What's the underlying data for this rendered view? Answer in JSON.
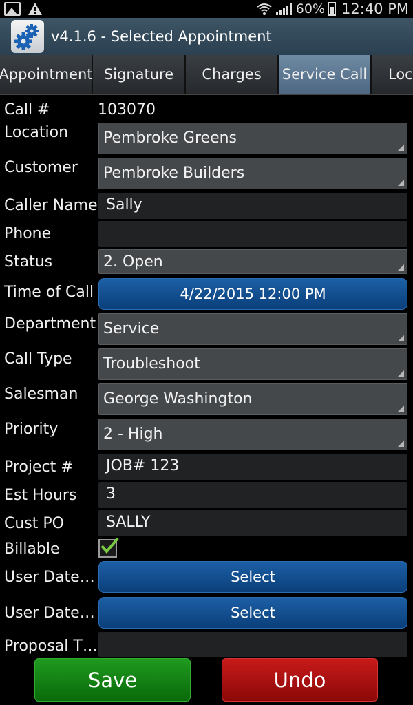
{
  "status_bar": {
    "battery": "60%",
    "time": "12:40 PM",
    "icons": [
      "image-notification-icon",
      "warning-icon",
      "wifi-icon",
      "signal-icon",
      "battery-icon"
    ]
  },
  "title_bar": {
    "title": "v4.1.6 - Selected Appointment",
    "icon": "gears-app-icon"
  },
  "tabs": [
    {
      "label": "Appointment",
      "active": false
    },
    {
      "label": "Signature",
      "active": false
    },
    {
      "label": "Charges",
      "active": false
    },
    {
      "label": "Service Call",
      "active": true
    },
    {
      "label": "Loc",
      "active": false
    }
  ],
  "form": {
    "call_number": {
      "label": "Call #",
      "value": "103070"
    },
    "location": {
      "label": "Location",
      "value": "Pembroke Greens"
    },
    "customer": {
      "label": "Customer",
      "value": "Pembroke Builders"
    },
    "caller_name": {
      "label": "Caller Name",
      "value": "Sally"
    },
    "phone": {
      "label": "Phone",
      "value": ""
    },
    "status": {
      "label": "Status",
      "value": "2. Open"
    },
    "time_of_call": {
      "label": "Time of Call",
      "value": "4/22/2015 12:00 PM"
    },
    "department": {
      "label": "Department",
      "value": "Service"
    },
    "call_type": {
      "label": "Call Type",
      "value": "Troubleshoot"
    },
    "salesman": {
      "label": "Salesman",
      "value": "George Washington"
    },
    "priority": {
      "label": "Priority",
      "value": "2 - High"
    },
    "project_number": {
      "label": "Project #",
      "value": "JOB# 123"
    },
    "est_hours": {
      "label": "Est Hours",
      "value": "3"
    },
    "cust_po": {
      "label": "Cust PO",
      "value": "SALLY"
    },
    "billable": {
      "label": "Billable",
      "checked": true
    },
    "user_date_1": {
      "label": "User Date…",
      "button": "Select"
    },
    "user_date_2": {
      "label": "User Date…",
      "button": "Select"
    },
    "proposal": {
      "label": "Proposal T…",
      "value": ""
    }
  },
  "actions": {
    "save": "Save",
    "undo": "Undo"
  },
  "colors": {
    "accent_blue": "#1d5fa6",
    "save_green": "#1f9a1f",
    "undo_red": "#c81a1a",
    "active_tab": "#6f8aa3",
    "check_green": "#7ac943"
  }
}
